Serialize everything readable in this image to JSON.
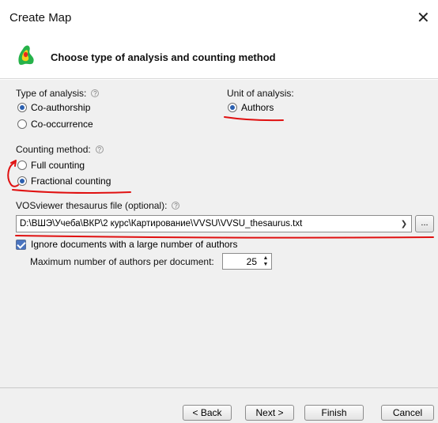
{
  "window": {
    "title": "Create Map"
  },
  "header": {
    "text": "Choose type of analysis and counting method",
    "icon": "vosviewer-map-icon"
  },
  "type_of_analysis": {
    "label": "Type of analysis:",
    "options": [
      {
        "label": "Co-authorship",
        "selected": true
      },
      {
        "label": "Co-occurrence",
        "selected": false
      }
    ]
  },
  "unit_of_analysis": {
    "label": "Unit of analysis:",
    "options": [
      {
        "label": "Authors",
        "selected": true
      }
    ]
  },
  "counting_method": {
    "label": "Counting method:",
    "options": [
      {
        "label": "Full counting",
        "selected": false
      },
      {
        "label": "Fractional counting",
        "selected": true
      }
    ]
  },
  "thesaurus": {
    "label": "VOSviewer thesaurus file (optional):",
    "value": "D:\\ВШЭ\\Учеба\\ВКР\\2 курс\\Картирование\\VVSU\\VVSU_thesaurus.txt",
    "browse_label": "..."
  },
  "ignore_documents": {
    "label": "Ignore documents with a large number of authors",
    "checked": true,
    "max_label": "Maximum number of authors per document:",
    "max_value": "25"
  },
  "buttons": {
    "back": "< Back",
    "next": "Next >",
    "finish": "Finish",
    "cancel": "Cancel"
  },
  "colors": {
    "accent": "#2a5fb0",
    "annotation": "#e01010",
    "panel": "#f0f0f0"
  }
}
